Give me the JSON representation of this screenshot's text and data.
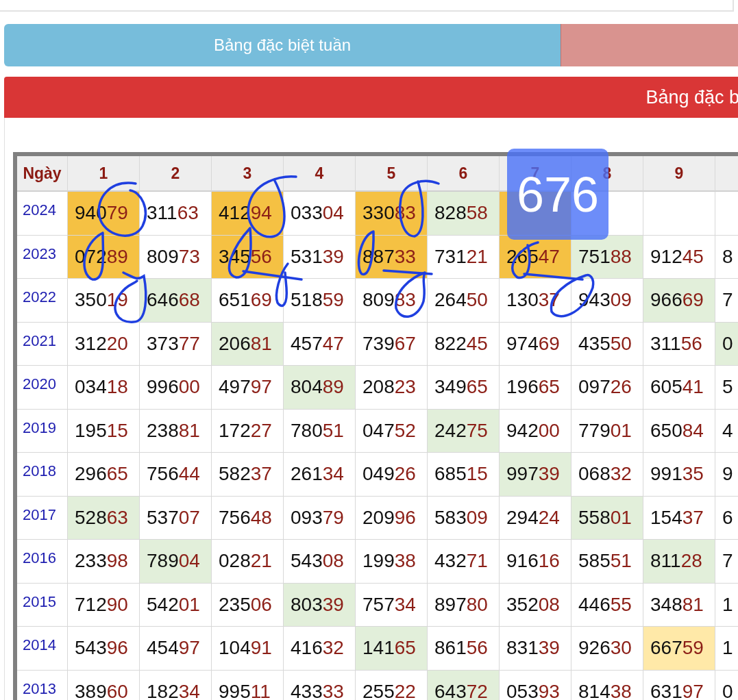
{
  "tabs": [
    {
      "label": "Bảng đặc biệt tuần",
      "selected": true
    },
    {
      "selected": false
    }
  ],
  "section_title": "Bảng đặc b",
  "overlay_badge": "676",
  "table": {
    "corner_label": "Ngày",
    "columns": [
      "1",
      "2",
      "3",
      "4",
      "5",
      "6",
      "7",
      "8",
      "9"
    ],
    "rows": [
      {
        "year": "2024",
        "cells": [
          {
            "head": "940",
            "tail": "79",
            "color": "#f5c143"
          },
          {
            "head": "311",
            "tail": "63"
          },
          {
            "head": "412",
            "tail": "94",
            "color": "#f5c143"
          },
          {
            "head": "033",
            "tail": "04"
          },
          {
            "head": "330",
            "tail": "83",
            "color": "#f5c143"
          },
          {
            "head": "828",
            "tail": "58",
            "color": "#e2efda"
          },
          {
            "color": "#f5c143"
          },
          {},
          {},
          {}
        ]
      },
      {
        "year": "2023",
        "cells": [
          {
            "head": "072",
            "tail": "89",
            "color": "#f5c143"
          },
          {
            "head": "809",
            "tail": "73"
          },
          {
            "head": "345",
            "tail": "56",
            "color": "#f5c143"
          },
          {
            "head": "531",
            "tail": "39"
          },
          {
            "head": "887",
            "tail": "33",
            "color": "#f5c143"
          },
          {
            "head": "731",
            "tail": "21"
          },
          {
            "head": "265",
            "tail": "47",
            "color": "#f5c143"
          },
          {
            "head": "751",
            "tail": "88",
            "color": "#e2efda"
          },
          {
            "head": "912",
            "tail": "45"
          },
          {
            "head": "8"
          }
        ]
      },
      {
        "year": "2022",
        "cells": [
          {
            "head": "350",
            "tail": "19"
          },
          {
            "head": "646",
            "tail": "68",
            "color": "#e2efda"
          },
          {
            "head": "651",
            "tail": "69"
          },
          {
            "head": "518",
            "tail": "59"
          },
          {
            "head": "809",
            "tail": "83"
          },
          {
            "head": "264",
            "tail": "50"
          },
          {
            "head": "130",
            "tail": "37"
          },
          {
            "head": "943",
            "tail": "09"
          },
          {
            "head": "966",
            "tail": "69",
            "color": "#e2efda"
          },
          {
            "head": "7"
          }
        ]
      },
      {
        "year": "2021",
        "cells": [
          {
            "head": "312",
            "tail": "20"
          },
          {
            "head": "373",
            "tail": "77"
          },
          {
            "head": "206",
            "tail": "81",
            "color": "#e2efda"
          },
          {
            "head": "457",
            "tail": "47"
          },
          {
            "head": "739",
            "tail": "67"
          },
          {
            "head": "822",
            "tail": "45"
          },
          {
            "head": "974",
            "tail": "69"
          },
          {
            "head": "435",
            "tail": "50"
          },
          {
            "head": "311",
            "tail": "56"
          },
          {
            "head": "0",
            "color": "#e2efda"
          }
        ]
      },
      {
        "year": "2020",
        "cells": [
          {
            "head": "034",
            "tail": "18"
          },
          {
            "head": "996",
            "tail": "00"
          },
          {
            "head": "497",
            "tail": "97"
          },
          {
            "head": "804",
            "tail": "89",
            "color": "#e2efda"
          },
          {
            "head": "208",
            "tail": "23"
          },
          {
            "head": "349",
            "tail": "65"
          },
          {
            "head": "196",
            "tail": "65"
          },
          {
            "head": "097",
            "tail": "26"
          },
          {
            "head": "605",
            "tail": "41"
          },
          {
            "head": "5"
          }
        ]
      },
      {
        "year": "2019",
        "cells": [
          {
            "head": "195",
            "tail": "15"
          },
          {
            "head": "238",
            "tail": "81"
          },
          {
            "head": "172",
            "tail": "27"
          },
          {
            "head": "780",
            "tail": "51"
          },
          {
            "head": "047",
            "tail": "52"
          },
          {
            "head": "242",
            "tail": "75",
            "color": "#e2efda"
          },
          {
            "head": "942",
            "tail": "00"
          },
          {
            "head": "779",
            "tail": "01"
          },
          {
            "head": "650",
            "tail": "84"
          },
          {
            "head": "4"
          }
        ]
      },
      {
        "year": "2018",
        "cells": [
          {
            "head": "296",
            "tail": "65"
          },
          {
            "head": "756",
            "tail": "44"
          },
          {
            "head": "582",
            "tail": "37"
          },
          {
            "head": "261",
            "tail": "34"
          },
          {
            "head": "049",
            "tail": "26"
          },
          {
            "head": "685",
            "tail": "15"
          },
          {
            "head": "997",
            "tail": "39",
            "color": "#e2efda"
          },
          {
            "head": "068",
            "tail": "32"
          },
          {
            "head": "991",
            "tail": "35"
          },
          {
            "head": "9"
          }
        ]
      },
      {
        "year": "2017",
        "cells": [
          {
            "head": "528",
            "tail": "63",
            "color": "#e2efda"
          },
          {
            "head": "537",
            "tail": "07"
          },
          {
            "head": "756",
            "tail": "48"
          },
          {
            "head": "093",
            "tail": "79"
          },
          {
            "head": "209",
            "tail": "96"
          },
          {
            "head": "583",
            "tail": "09"
          },
          {
            "head": "294",
            "tail": "24"
          },
          {
            "head": "558",
            "tail": "01",
            "color": "#e2efda"
          },
          {
            "head": "154",
            "tail": "37"
          },
          {
            "head": "6"
          }
        ]
      },
      {
        "year": "2016",
        "cells": [
          {
            "head": "233",
            "tail": "98"
          },
          {
            "head": "789",
            "tail": "04",
            "color": "#e2efda"
          },
          {
            "head": "028",
            "tail": "21"
          },
          {
            "head": "543",
            "tail": "08"
          },
          {
            "head": "199",
            "tail": "38"
          },
          {
            "head": "432",
            "tail": "71"
          },
          {
            "head": "916",
            "tail": "16"
          },
          {
            "head": "585",
            "tail": "51"
          },
          {
            "head": "811",
            "tail": "28",
            "color": "#e2efda"
          },
          {
            "head": "7"
          }
        ]
      },
      {
        "year": "2015",
        "cells": [
          {
            "head": "712",
            "tail": "90"
          },
          {
            "head": "542",
            "tail": "01"
          },
          {
            "head": "235",
            "tail": "06"
          },
          {
            "head": "803",
            "tail": "39",
            "color": "#e2efda"
          },
          {
            "head": "757",
            "tail": "34"
          },
          {
            "head": "897",
            "tail": "80"
          },
          {
            "head": "352",
            "tail": "08"
          },
          {
            "head": "446",
            "tail": "55"
          },
          {
            "head": "348",
            "tail": "81"
          },
          {
            "head": "1"
          }
        ]
      },
      {
        "year": "2014",
        "cells": [
          {
            "head": "543",
            "tail": "96"
          },
          {
            "head": "454",
            "tail": "97"
          },
          {
            "head": "104",
            "tail": "91"
          },
          {
            "head": "416",
            "tail": "32"
          },
          {
            "head": "141",
            "tail": "65",
            "color": "#e2efda"
          },
          {
            "head": "861",
            "tail": "56"
          },
          {
            "head": "831",
            "tail": "39"
          },
          {
            "head": "926",
            "tail": "30"
          },
          {
            "head": "667",
            "tail": "59",
            "color": "#ffe9a8"
          },
          {
            "head": "1"
          }
        ]
      },
      {
        "year": "2013",
        "cells": [
          {
            "head": "389",
            "tail": "60"
          },
          {
            "head": "182",
            "tail": "34"
          },
          {
            "head": "995",
            "tail": "11"
          },
          {
            "head": "433",
            "tail": "33"
          },
          {
            "head": "255",
            "tail": "22"
          },
          {
            "head": "643",
            "tail": "72",
            "color": "#e2efda"
          },
          {
            "head": "053",
            "tail": "93"
          },
          {
            "head": "814",
            "tail": "38"
          },
          {
            "head": "631",
            "tail": "97"
          },
          {
            "head": "0"
          }
        ]
      }
    ]
  }
}
